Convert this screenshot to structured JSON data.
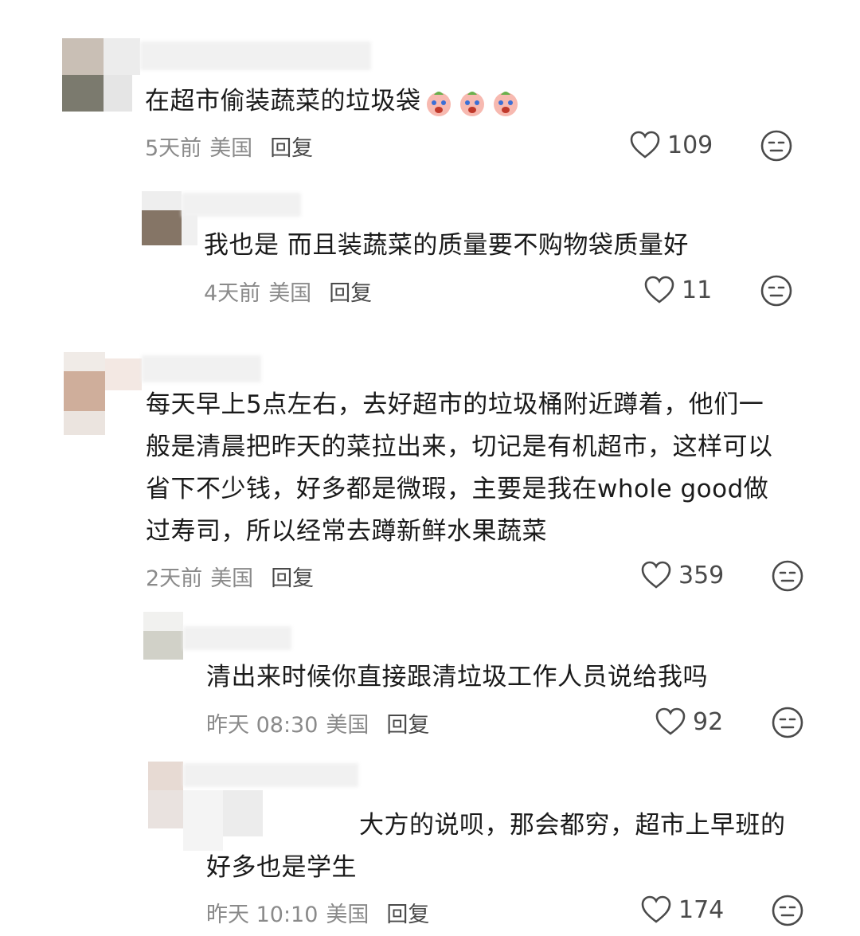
{
  "comments": [
    {
      "text": "在超市偷装蔬菜的垃圾袋",
      "emoji_icons": [
        "crying-baby-emoji",
        "crying-baby-emoji",
        "crying-baby-emoji"
      ],
      "time": "5天前",
      "location": "美国",
      "reply_label": "回复",
      "likes": "109"
    },
    {
      "text": "我也是 而且装蔬菜的质量要不购物袋质量好",
      "time": "4天前",
      "location": "美国",
      "reply_label": "回复",
      "likes": "11"
    },
    {
      "text_lines": [
        "每天早上5点左右，去好超市的垃圾桶附近蹲着，他们一",
        "般是清晨把昨天的菜拉出来，切记是有机超市，这样可以",
        "省下不少钱，好多都是微瑕，主要是我在whole good做",
        "过寿司，所以经常去蹲新鲜水果蔬菜"
      ],
      "time": "2天前",
      "location": "美国",
      "reply_label": "回复",
      "likes": "359"
    },
    {
      "text": "清出来时候你直接跟清垃圾工作人员说给我吗",
      "time": "昨天 08:30",
      "location": "美国",
      "reply_label": "回复",
      "likes": "92"
    },
    {
      "text_lines": [
        "大方的说呗，那会都穷，超市上早班的",
        "好多也是学生"
      ],
      "time": "昨天 10:10",
      "location": "美国",
      "reply_label": "回复",
      "likes": "174"
    }
  ],
  "colors": {
    "text": "#1a1a1a",
    "meta": "#8a8a8a",
    "reply": "#4a4a4a",
    "icon": "#4a4a4a"
  }
}
